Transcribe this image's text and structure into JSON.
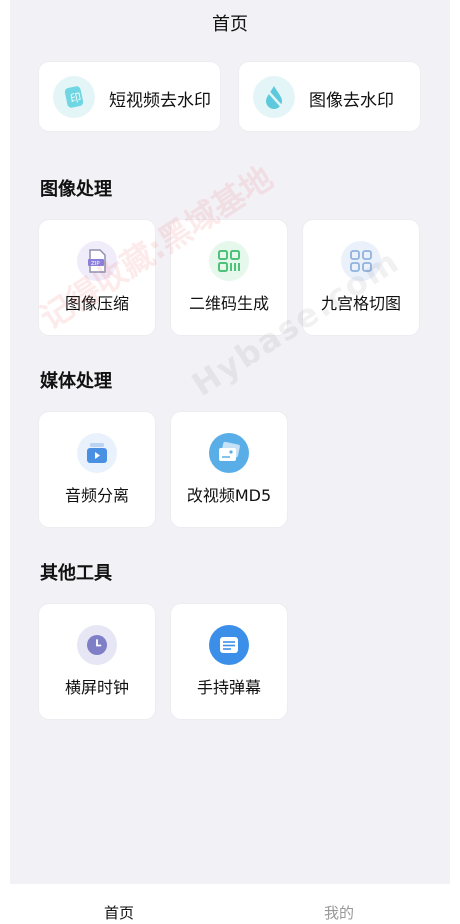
{
  "header": {
    "title": "首页"
  },
  "top_actions": [
    {
      "label": "短视频去水印",
      "icon": "video-watermark-icon"
    },
    {
      "label": "图像去水印",
      "icon": "image-watermark-icon"
    }
  ],
  "sections": [
    {
      "title": "图像处理",
      "items": [
        {
          "label": "图像压缩",
          "icon": "zip-compress-icon"
        },
        {
          "label": "二维码生成",
          "icon": "qrcode-icon"
        },
        {
          "label": "九宫格切图",
          "icon": "grid-icon"
        }
      ]
    },
    {
      "title": "媒体处理",
      "items": [
        {
          "label": "音频分离",
          "icon": "audio-separate-icon"
        },
        {
          "label": "改视频MD5",
          "icon": "video-md5-icon"
        }
      ]
    },
    {
      "title": "其他工具",
      "items": [
        {
          "label": "横屏时钟",
          "icon": "clock-icon"
        },
        {
          "label": "手持弹幕",
          "icon": "danmaku-icon"
        }
      ]
    }
  ],
  "watermark": {
    "text1": "记得收藏:黑域基地",
    "text2": "Hybase.com"
  },
  "tabs": [
    {
      "label": "首页",
      "active": true
    },
    {
      "label": "我的",
      "active": false
    }
  ],
  "colors": {
    "background": "#f2f1f6",
    "card": "#ffffff",
    "accent_blue": "#3b8fe8",
    "inactive_tab": "#999999"
  }
}
